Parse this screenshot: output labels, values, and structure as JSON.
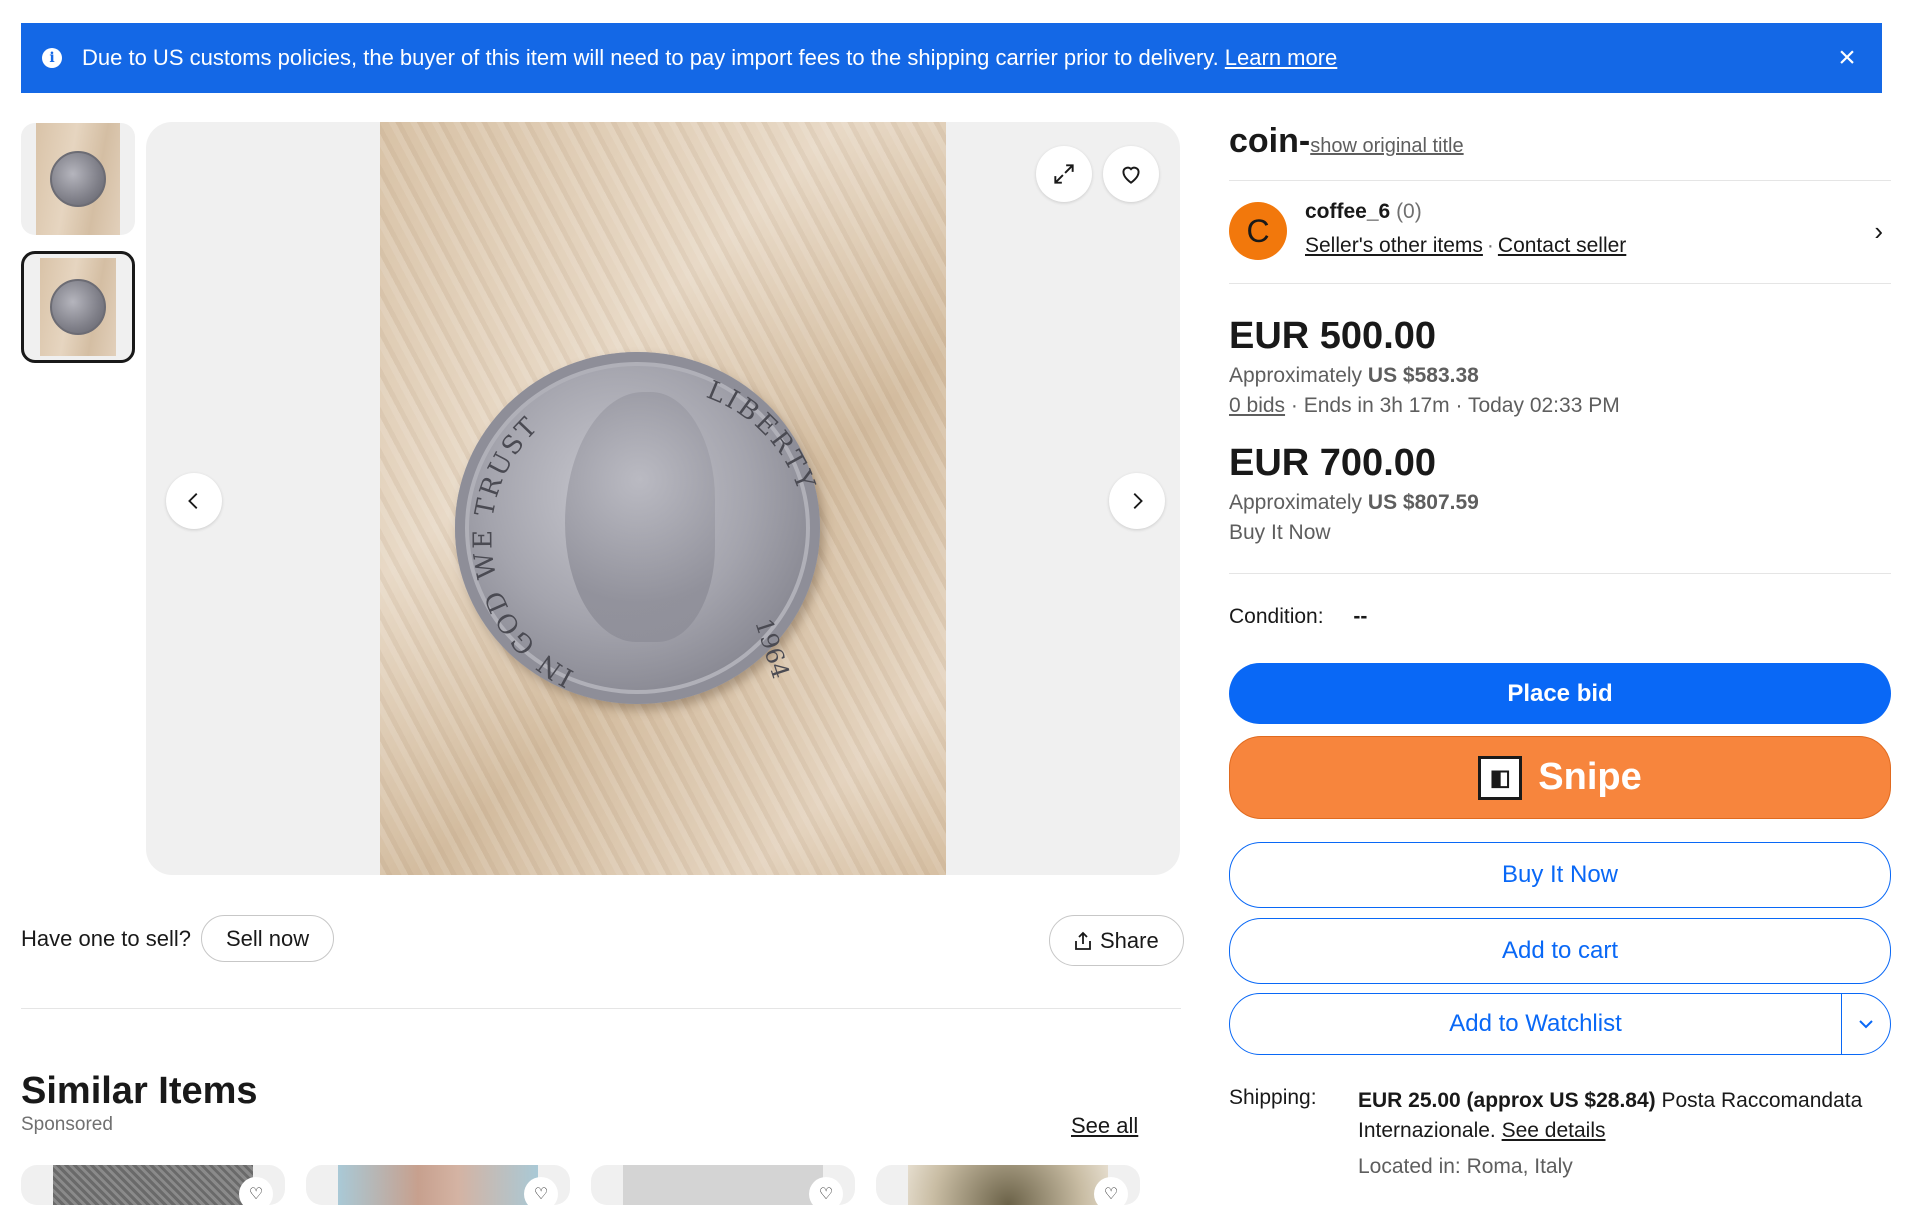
{
  "banner": {
    "message": "Due to US customs policies, the buyer of this item will need to pay import fees to the shipping carrier prior to delivery.",
    "link": "Learn more",
    "info_icon": "info-icon",
    "close_icon": "close-icon",
    "color": "#1468e6"
  },
  "gallery": {
    "thumbnails": [
      "coin-photo-1",
      "coin-photo-2"
    ],
    "coin_legend_left": "IN GOD WE TRUST",
    "coin_legend_right": "LIBERTY",
    "coin_year": "1964"
  },
  "sell": {
    "question": "Have one to sell?",
    "button": "Sell now",
    "share": "Share"
  },
  "similar": {
    "title": "Similar Items",
    "sponsored": "Sponsored",
    "see_all": "See all"
  },
  "listing": {
    "title": "coin-",
    "show_original": "show original title",
    "seller": {
      "initial": "C",
      "name": "coffee_6",
      "feedback": "(0)",
      "other_items": "Seller's other items",
      "contact": "Contact seller"
    },
    "auction": {
      "price": "EUR 500.00",
      "approx_label": "Approximately",
      "approx_value": "US $583.38",
      "bids": "0 bids",
      "ends": "Ends in 3h 17m",
      "end_time": "Today 02:33 PM"
    },
    "buy_now": {
      "price": "EUR 700.00",
      "approx_label": "Approximately",
      "approx_value": "US $807.59",
      "label": "Buy It Now"
    },
    "condition_label": "Condition:",
    "condition_value": "--",
    "buttons": {
      "place_bid": "Place bid",
      "snipe": "Snipe",
      "buy_now": "Buy It Now",
      "add_to_cart": "Add to cart",
      "add_to_watchlist": "Add to Watchlist"
    },
    "shipping": {
      "label": "Shipping:",
      "cost": "EUR 25.00 (approx US $28.84)",
      "method": "Posta Raccomandata Internazionale.",
      "details": "See details",
      "located": "Located in: Roma, Italy"
    }
  },
  "colors": {
    "primary": "#0968f6",
    "snipe": "#f7853d",
    "avatar": "#f2780c"
  }
}
